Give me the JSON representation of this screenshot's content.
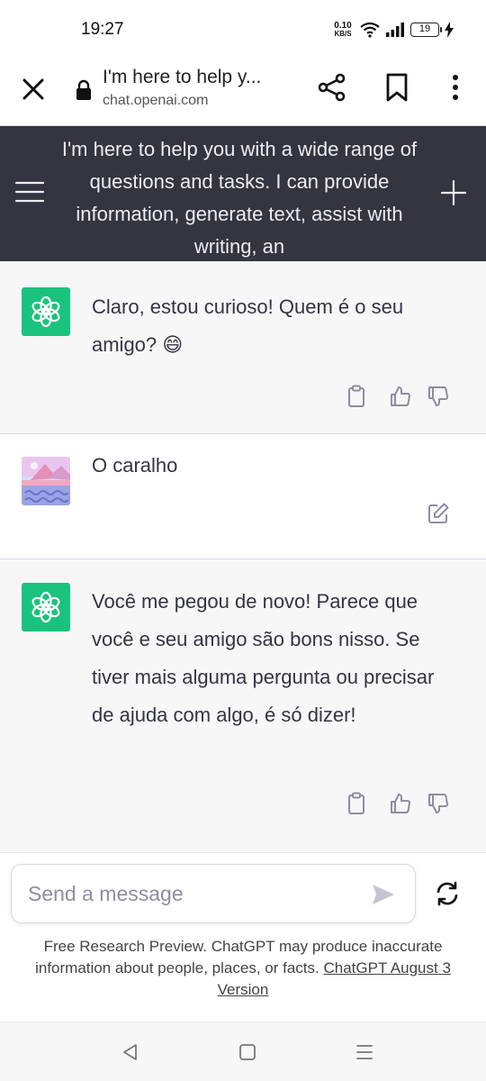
{
  "status_bar": {
    "time": "19:27",
    "net_speed_value": "0.10",
    "net_speed_unit": "KB/S",
    "battery": "19"
  },
  "browser": {
    "tab_title": "I'm here to help y...",
    "url": "chat.openai.com"
  },
  "header": {
    "title": "I'm here to help you with a wide range of questions and tasks. I can provide information, generate text, assist with writing, an"
  },
  "messages": [
    {
      "role": "assistant",
      "text": "Claro, estou curioso! Quem é o seu amigo? 😄"
    },
    {
      "role": "user",
      "text": "O caralho"
    },
    {
      "role": "assistant",
      "text": "Você me pegou de novo! Parece que você e seu amigo são bons nisso. Se tiver mais alguma pergunta ou precisar de ajuda com algo, é só dizer!"
    }
  ],
  "composer": {
    "placeholder": "Send a message"
  },
  "footer": {
    "disclaimer": "Free Research Preview. ChatGPT may produce inaccurate information about people, places, or facts.",
    "version_link": "ChatGPT August 3 Version"
  },
  "colors": {
    "header_bg": "#343541",
    "gpt_green": "#19c37d",
    "assistant_bg": "#f7f7f8"
  },
  "icons": {
    "browser": [
      "close-icon",
      "lock-icon",
      "share-icon",
      "bookmark-icon",
      "more-vert-icon"
    ],
    "header": [
      "menu-icon",
      "plus-icon"
    ],
    "actions": [
      "clipboard-icon",
      "thumbs-up-icon",
      "thumbs-down-icon",
      "edit-icon"
    ],
    "composer": [
      "send-icon",
      "regenerate-icon"
    ],
    "nav": [
      "back-icon",
      "home-icon",
      "recents-icon"
    ]
  }
}
